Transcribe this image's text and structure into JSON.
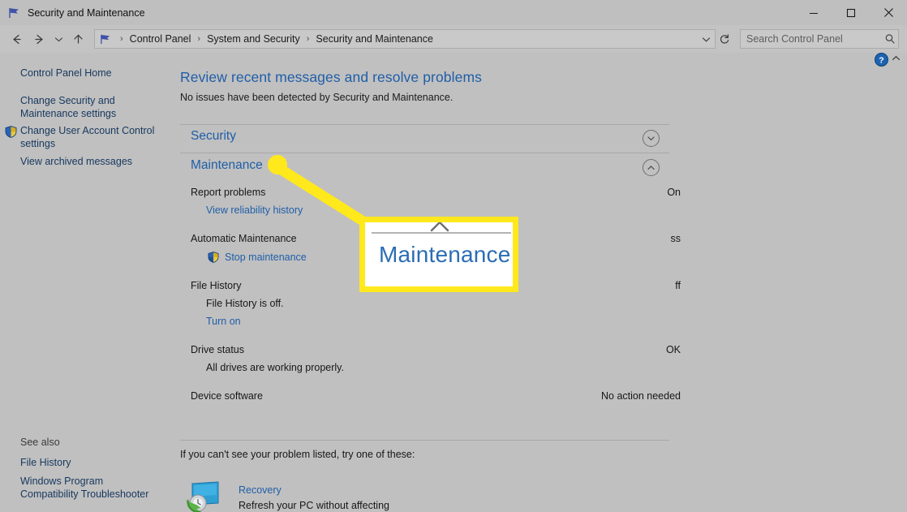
{
  "window": {
    "title": "Security and Maintenance",
    "icon": "flag-icon",
    "controls": {
      "minimize": "minimize-button",
      "maximize": "maximize-button",
      "close": "close-button"
    }
  },
  "address_bar": {
    "back": "back-arrow-icon",
    "forward": "forward-arrow-icon",
    "history": "history-dropdown-icon",
    "up": "up-arrow-icon",
    "breadcrumbs": [
      "Control Panel",
      "System and Security",
      "Security and Maintenance"
    ],
    "separator": "›",
    "dropdown": "chevron-down-icon",
    "refresh": "refresh-icon",
    "search_placeholder": "Search Control Panel",
    "search_value": ""
  },
  "help": {
    "icon": "help-circle-icon",
    "chevron": "chevron-up-icon"
  },
  "sidebar": {
    "items": [
      {
        "label": "Control Panel Home",
        "icon": null
      },
      {
        "label": "Change Security and\nMaintenance settings",
        "icon": null
      },
      {
        "label": "Change User Account Control\nsettings",
        "icon": "uac-shield-icon"
      },
      {
        "label": "View archived messages",
        "icon": null
      }
    ],
    "see_also_label": "See also",
    "see_also_items": [
      {
        "label": "File History"
      },
      {
        "label": "Windows Program\nCompatibility Troubleshooter"
      }
    ]
  },
  "main": {
    "title": "Review recent messages and resolve problems",
    "subtitle": "No issues have been detected by Security and Maintenance.",
    "sections": [
      {
        "name": "Security",
        "expanded": false,
        "chevron": "chevron-down-icon"
      },
      {
        "name": "Maintenance",
        "expanded": true,
        "chevron": "chevron-up-icon"
      }
    ],
    "rows": [
      {
        "label": "Report problems",
        "status": "On",
        "sub": null,
        "link": "View reliability history",
        "link_shield": false
      },
      {
        "label": "Automatic Maintenance",
        "status": "ss",
        "sub": null,
        "link": "Stop maintenance",
        "link_shield": true
      },
      {
        "label": "File History",
        "status": "ff",
        "sub": "File History is off.",
        "link": "Turn on",
        "link_shield": false
      },
      {
        "label": "Drive status",
        "status": "OK",
        "sub": "All drives are working properly.",
        "link": null,
        "link_shield": false
      },
      {
        "label": "Device software",
        "status": "No action needed",
        "sub": null,
        "link": null,
        "link_shield": false
      }
    ],
    "bottom_prompt": "If you can't see your problem listed, try one of these:",
    "recovery": {
      "title": "Recovery",
      "description": "Refresh your PC without affecting",
      "icon": "recovery-monitor-icon"
    }
  },
  "callout": {
    "zoom_text": "Maintenance",
    "border_color": "#ffe81c",
    "dot_color": "#ffe81c"
  },
  "colors": {
    "accent_link": "#1f5ea8",
    "title_blue": "#1f5ea8",
    "window_bg": "#c0c0c0",
    "highlight_yellow": "#ffe81c"
  }
}
